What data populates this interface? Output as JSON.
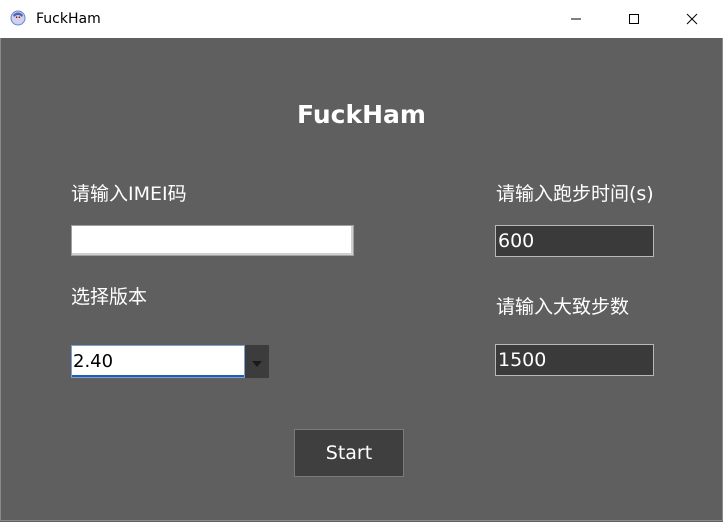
{
  "window": {
    "title": "FuckHam",
    "app_icon": "app-logo-icon",
    "controls": [
      "minimize-icon",
      "maximize-icon",
      "close-icon"
    ]
  },
  "form": {
    "heading": "FuckHam",
    "imei": {
      "label": "请输入IMEI码",
      "value": ""
    },
    "runtime": {
      "label": "请输入跑步时间(s)",
      "value": "600"
    },
    "version": {
      "label": "选择版本",
      "selected": "2.40"
    },
    "steps": {
      "label": "请输入大致步数",
      "value": "1500"
    },
    "start_label": "Start"
  },
  "colors": {
    "background": "#5f5f5f",
    "dark_input": "#3a3a3a",
    "button": "#3f3f3f",
    "text": "#ffffff"
  }
}
